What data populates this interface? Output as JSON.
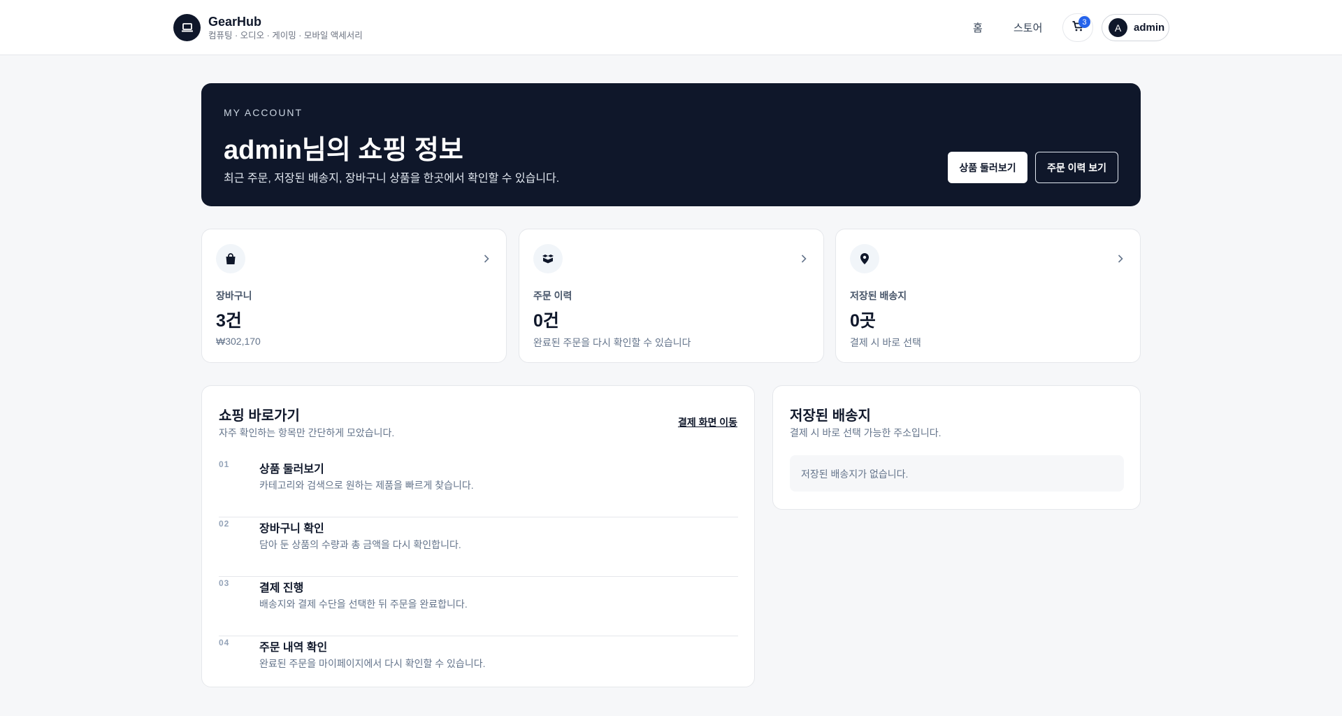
{
  "header": {
    "brand_name": "GearHub",
    "brand_tagline": "컴퓨팅 · 오디오 · 게이밍 · 모바일 액세서리",
    "nav_home": "홈",
    "nav_store": "스토어",
    "cart_count": "3",
    "user_initial": "A",
    "user_name": "admin"
  },
  "hero": {
    "eyebrow": "MY ACCOUNT",
    "title": "admin님의 쇼핑 정보",
    "description": "최근 주문, 저장된 배송지, 장바구니 상품을 한곳에서 확인할 수 있습니다.",
    "browse_button": "상품 둘러보기",
    "orders_button": "주문 이력 보기"
  },
  "stats": [
    {
      "icon": "shopping-bag-icon",
      "label": "장바구니",
      "value": "3건",
      "sub": "₩302,170"
    },
    {
      "icon": "boxes-icon",
      "label": "주문 이력",
      "value": "0건",
      "sub": "완료된 주문을 다시 확인할 수 있습니다"
    },
    {
      "icon": "map-pin-icon",
      "label": "저장된 배송지",
      "value": "0곳",
      "sub": "결제 시 바로 선택"
    }
  ],
  "shortcuts": {
    "title": "쇼핑 바로가기",
    "description": "자주 확인하는 항목만 간단하게 모았습니다.",
    "checkout_link": "결제 화면 이동",
    "steps": [
      {
        "num": "01",
        "title": "상품 둘러보기",
        "desc": "카테고리와 검색으로 원하는 제품을 빠르게 찾습니다."
      },
      {
        "num": "02",
        "title": "장바구니 확인",
        "desc": "담아 둔 상품의 수량과 총 금액을 다시 확인합니다."
      },
      {
        "num": "03",
        "title": "결제 진행",
        "desc": "배송지와 결제 수단을 선택한 뒤 주문을 완료합니다."
      },
      {
        "num": "04",
        "title": "주문 내역 확인",
        "desc": "완료된 주문을 마이페이지에서 다시 확인할 수 있습니다."
      }
    ]
  },
  "addresses": {
    "title": "저장된 배송지",
    "description": "결제 시 바로 선택 가능한 주소입니다.",
    "empty_message": "저장된 배송지가 없습니다."
  },
  "colors": {
    "dark": "#0f172a",
    "badge": "#2563eb",
    "background": "#f6f7f9"
  }
}
